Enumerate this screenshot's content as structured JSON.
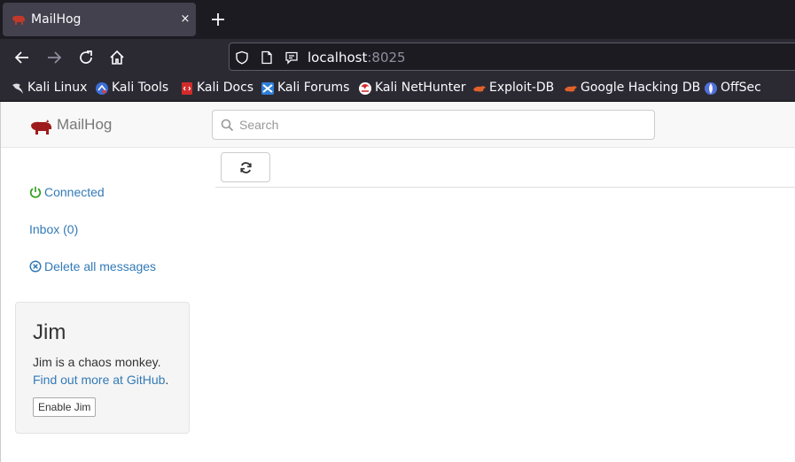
{
  "browser": {
    "tab": {
      "title": "MailHog",
      "close_glyph": "×"
    },
    "new_tab_icon": "plus-icon",
    "url": {
      "host": "localhost",
      "port": ":8025"
    },
    "bookmarks": [
      {
        "label": "Kali Linux",
        "icon": "kali-dragon-icon"
      },
      {
        "label": "Kali Tools",
        "icon": "kali-tools-icon"
      },
      {
        "label": "Kali Docs",
        "icon": "kali-docs-icon"
      },
      {
        "label": "Kali Forums",
        "icon": "kali-forums-icon"
      },
      {
        "label": "Kali NetHunter",
        "icon": "nethunter-icon"
      },
      {
        "label": "Exploit-DB",
        "icon": "exploit-db-icon"
      },
      {
        "label": "Google Hacking DB",
        "icon": "ghdb-icon"
      },
      {
        "label": "OffSec",
        "icon": "offsec-icon"
      }
    ]
  },
  "app": {
    "brand": "MailHog",
    "search_placeholder": "Search",
    "sidebar": {
      "connected": "Connected",
      "inbox": "Inbox (0)",
      "delete_all": "Delete all messages"
    },
    "jim": {
      "title": "Jim",
      "description": "Jim is a chaos monkey.",
      "link_text": "Find out more at GitHub",
      "link_suffix": ".",
      "button": "Enable Jim"
    }
  },
  "colors": {
    "link": "#337ab7",
    "connected": "#2a9d14",
    "brand_logo": "#9e1b1b",
    "chrome_bg": "#2b2a33"
  }
}
